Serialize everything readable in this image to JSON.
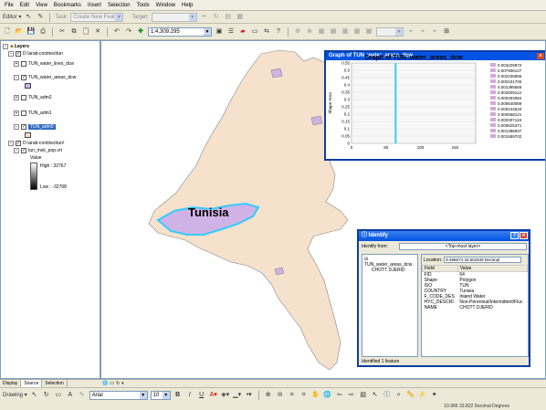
{
  "menubar": [
    "File",
    "Edit",
    "View",
    "Bookmarks",
    "Insert",
    "Selection",
    "Tools",
    "Window",
    "Help"
  ],
  "editor": {
    "editor_label": "Editor ▾",
    "task_label": "Task:",
    "task_value": "Create New Feature",
    "target_label": "Target:"
  },
  "standard": {
    "scale_value": "1:4,309,295"
  },
  "toc": {
    "root": "Layers",
    "folder1": "D:\\arab-contries\\tun",
    "layers": [
      {
        "name": "TUN_water_lines_dcw",
        "checked": false
      },
      {
        "name": "TUN_water_areas_dcw",
        "checked": true
      },
      {
        "name": "TUN_adm2",
        "checked": false
      },
      {
        "name": "TUN_adm1",
        "checked": false
      },
      {
        "name": "TUN_adm0",
        "checked": true
      }
    ],
    "folder2": "D:\\arab-contries\\tun\\",
    "raster": "tun_msk_pop.vrt",
    "value_label": "Value",
    "high_label": "High : 32767",
    "low_label": "Low : -32768",
    "tabs": [
      "Display",
      "Source",
      "Selection"
    ]
  },
  "map": {
    "label": "Tunisia"
  },
  "graph": {
    "window_title": "Graph of TUN_water_areas_dcw",
    "close": "x",
    "chart_data": {
      "type": "bar",
      "title": "Graph of TUN_water_areas_dcw",
      "ylabel": "Shape Area",
      "xlabel": "",
      "ylim": [
        0,
        0.55
      ],
      "xlim": [
        0,
        180
      ],
      "y_ticks": [
        "0.55",
        "0.5",
        "0.45",
        "0.4",
        "0.35",
        "0.3",
        "0.25",
        "0.2",
        "0.15",
        "0.1",
        "0.05",
        "0"
      ],
      "x_ticks": [
        "0",
        "50",
        "100",
        "150"
      ],
      "bars": [
        {
          "x": 64,
          "value": 0.55
        }
      ],
      "legend": [
        "0.003226872",
        "0.007906127",
        "0.002235896",
        "0.000431706",
        "0.001395566",
        "0.002609112",
        "0.000403084",
        "0.000640089",
        "0.000244634",
        "0.000558121",
        "0.000307119",
        "0.000625371",
        "0.001396937",
        "0.001559702"
      ],
      "legend_color": "#d3a9d8",
      "bar_color": "#33ccff"
    }
  },
  "identify": {
    "title": "Identify",
    "from_label": "Identify from:",
    "from_value": "<Top-most layer>",
    "tree_layer": "TUN_water_areas_dcw",
    "tree_feature": "CHOTT DJERID",
    "location_label": "Location:",
    "location_value": "8.496674 33.601849 Decimal",
    "field_header": "Field",
    "value_header": "Value",
    "rows": [
      {
        "field": "FID",
        "value": "64"
      },
      {
        "field": "Shape",
        "value": "Polygon"
      },
      {
        "field": "ISO",
        "value": "TUN"
      },
      {
        "field": "COUNTRY",
        "value": "Tunisia"
      },
      {
        "field": "F_CODE_DES",
        "value": "Inland Water"
      },
      {
        "field": "HYC_DESCRI",
        "value": "Non-Perennial/Intermittent/Fluc"
      },
      {
        "field": "NAME",
        "value": "CHOTT DJERID"
      }
    ],
    "status": "Identified 1 feature"
  },
  "drawing": {
    "drawing_label": "Drawing ▾",
    "font_value": "Arial",
    "size_value": "10",
    "bold": "B",
    "italic": "I",
    "underline": "U",
    "text_a": "A"
  },
  "status": {
    "coords": "10.966  33.822 Decimal Degrees"
  },
  "colors": {
    "land": "#f5e1cc",
    "water": "#33ccff",
    "water_fill": "#d0b3e6"
  }
}
